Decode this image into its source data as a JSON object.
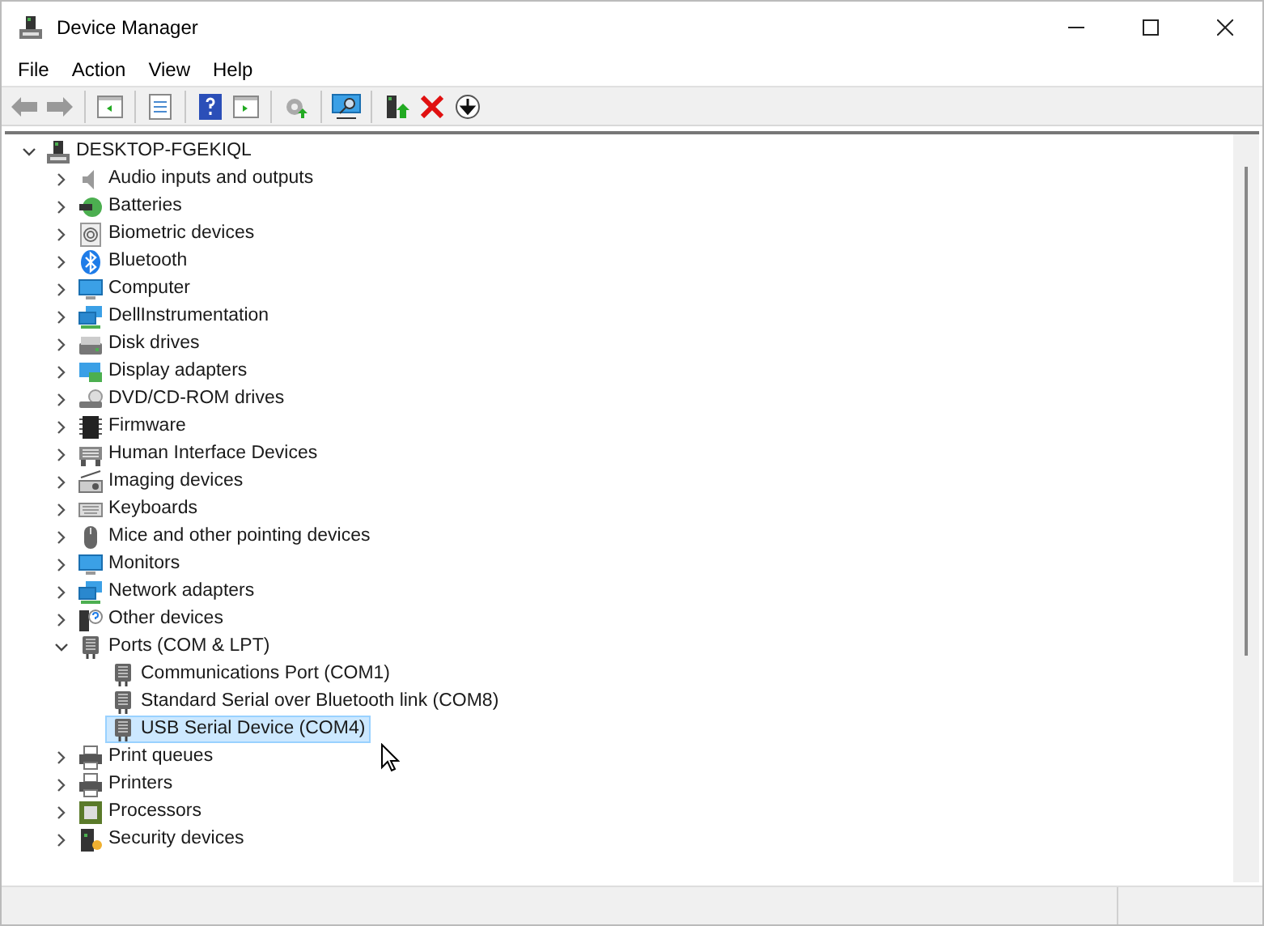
{
  "window": {
    "title": "Device Manager"
  },
  "menu": [
    "File",
    "Action",
    "View",
    "Help"
  ],
  "tree": {
    "label": "DESKTOP-FGEKIQL",
    "expanded": true,
    "selected": false,
    "children": [
      {
        "label": "Audio inputs and outputs",
        "expanded": false,
        "selected": false
      },
      {
        "label": "Batteries",
        "expanded": false,
        "selected": false
      },
      {
        "label": "Biometric devices",
        "expanded": false,
        "selected": false
      },
      {
        "label": "Bluetooth",
        "expanded": false,
        "selected": false
      },
      {
        "label": "Computer",
        "expanded": false,
        "selected": false
      },
      {
        "label": "DellInstrumentation",
        "expanded": false,
        "selected": false
      },
      {
        "label": "Disk drives",
        "expanded": false,
        "selected": false
      },
      {
        "label": "Display adapters",
        "expanded": false,
        "selected": false
      },
      {
        "label": "DVD/CD-ROM drives",
        "expanded": false,
        "selected": false
      },
      {
        "label": "Firmware",
        "expanded": false,
        "selected": false
      },
      {
        "label": "Human Interface Devices",
        "expanded": false,
        "selected": false
      },
      {
        "label": "Imaging devices",
        "expanded": false,
        "selected": false
      },
      {
        "label": "Keyboards",
        "expanded": false,
        "selected": false
      },
      {
        "label": "Mice and other pointing devices",
        "expanded": false,
        "selected": false
      },
      {
        "label": "Monitors",
        "expanded": false,
        "selected": false
      },
      {
        "label": "Network adapters",
        "expanded": false,
        "selected": false
      },
      {
        "label": "Other devices",
        "expanded": false,
        "selected": false
      },
      {
        "label": "Ports (COM & LPT)",
        "expanded": true,
        "selected": false,
        "children": [
          {
            "label": "Communications Port (COM1)",
            "selected": false
          },
          {
            "label": "Standard Serial over Bluetooth link (COM8)",
            "selected": false
          },
          {
            "label": "USB Serial Device (COM4)",
            "selected": true
          }
        ]
      },
      {
        "label": "Print queues",
        "expanded": false,
        "selected": false
      },
      {
        "label": "Printers",
        "expanded": false,
        "selected": false
      },
      {
        "label": "Processors",
        "expanded": false,
        "selected": false
      },
      {
        "label": "Security devices",
        "expanded": false,
        "selected": false
      }
    ]
  }
}
